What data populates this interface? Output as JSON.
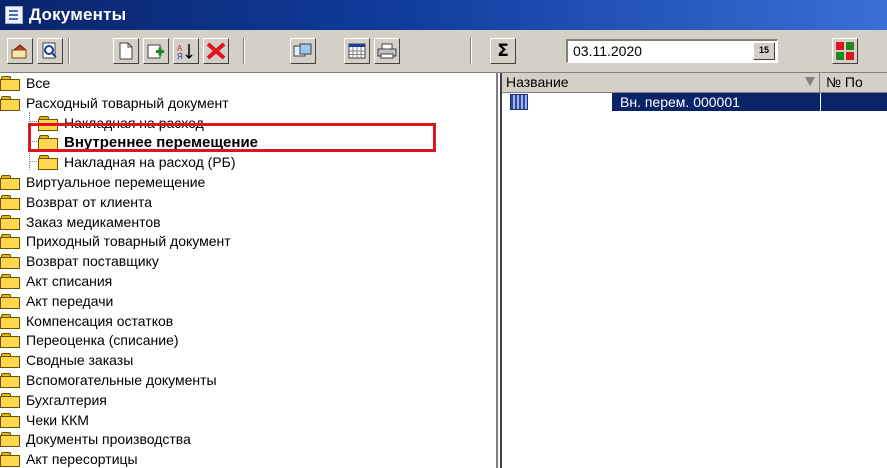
{
  "window": {
    "title": "Документы"
  },
  "toolbar": {
    "icons": [
      "properties-icon",
      "preview-icon",
      "new-document-icon",
      "add-icon",
      "sort-icon",
      "delete-icon",
      "copy-icon",
      "calendar-grid-icon",
      "print-icon",
      "sum-icon",
      "filter-icon"
    ],
    "sum_label": "Σ",
    "date_value": "03.11.2020",
    "calendar_label": "15"
  },
  "tree": {
    "items": [
      {
        "label": "Все",
        "level": 0
      },
      {
        "label": "Расходный товарный документ",
        "level": 0
      },
      {
        "label": "Накладная на расход",
        "level": 1
      },
      {
        "label": "Внутреннее перемещение",
        "level": 1,
        "selected": true
      },
      {
        "label": "Накладная на расход (РБ)",
        "level": 1
      },
      {
        "label": "Виртуальное перемещение",
        "level": 0
      },
      {
        "label": "Возврат от клиента",
        "level": 0
      },
      {
        "label": "Заказ медикаментов",
        "level": 0
      },
      {
        "label": "Приходный товарный документ",
        "level": 0
      },
      {
        "label": "Возврат поставщику",
        "level": 0
      },
      {
        "label": "Акт списания",
        "level": 0
      },
      {
        "label": "Акт передачи",
        "level": 0
      },
      {
        "label": "Компенсация остатков",
        "level": 0
      },
      {
        "label": "Переоценка (списание)",
        "level": 0
      },
      {
        "label": "Сводные заказы",
        "level": 0
      },
      {
        "label": "Вспомогательные документы",
        "level": 0
      },
      {
        "label": "Бухгалтерия",
        "level": 0
      },
      {
        "label": "Чеки ККМ",
        "level": 0
      },
      {
        "label": "Документы производства",
        "level": 0
      },
      {
        "label": "Акт пересортицы",
        "level": 0
      }
    ]
  },
  "grid": {
    "columns": [
      "Название",
      "№ По"
    ],
    "rows": [
      {
        "name": "Вн. перем. 000001",
        "number": ""
      }
    ]
  },
  "colors": {
    "title_bar": "#0a246a",
    "selection": "#0a246a",
    "highlight_box": "#e0141e",
    "folder": "#ffd84d"
  }
}
